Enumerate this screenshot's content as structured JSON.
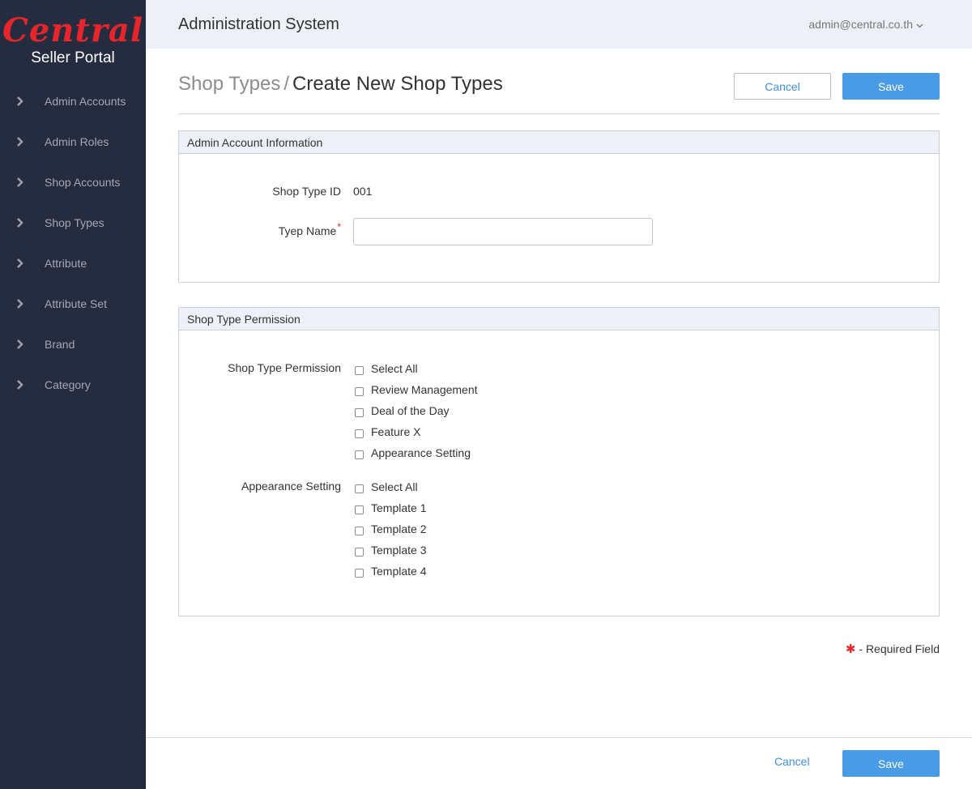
{
  "logo": {
    "brand": "Central",
    "subtitle": "Seller Portal"
  },
  "sidebar": {
    "items": [
      {
        "label": "Admin Accounts"
      },
      {
        "label": "Admin Roles"
      },
      {
        "label": "Shop Accounts"
      },
      {
        "label": "Shop Types"
      },
      {
        "label": "Attribute"
      },
      {
        "label": "Attribute Set"
      },
      {
        "label": "Brand"
      },
      {
        "label": "Category"
      }
    ]
  },
  "header": {
    "title": "Administration System",
    "user": "admin@central.co.th"
  },
  "breadcrumb": {
    "parent": "Shop Types",
    "separator": "/",
    "current": "Create New Shop Types"
  },
  "actions": {
    "cancel_label": "Cancel",
    "save_label": "Save"
  },
  "info_panel": {
    "title": "Admin Account Information",
    "id_label": "Shop Type ID",
    "id_value": "001",
    "name_label": "Tyep Name",
    "name_required_mark": "*",
    "name_value": ""
  },
  "perm_panel": {
    "title": "Shop Type Permission",
    "groups": [
      {
        "label": "Shop Type Permission",
        "options": [
          "Select All",
          "Review Management",
          "Deal of the Day",
          "Feature X",
          "Appearance Setting"
        ]
      },
      {
        "label": "Appearance Setting",
        "options": [
          "Select All",
          "Template 1",
          "Template 2",
          "Template 3",
          "Template 4"
        ]
      }
    ]
  },
  "required_note": {
    "mark": "✱",
    "text": "- Required Field"
  },
  "colors": {
    "sidebar_bg": "#252c3f",
    "accent_blue": "#4a9be6",
    "required_red": "#e8252a",
    "topbar_bg": "#edf1f7"
  },
  "icons": {
    "nav_item": "chevron-right-icon",
    "user_menu": "chevron-down-icon"
  }
}
